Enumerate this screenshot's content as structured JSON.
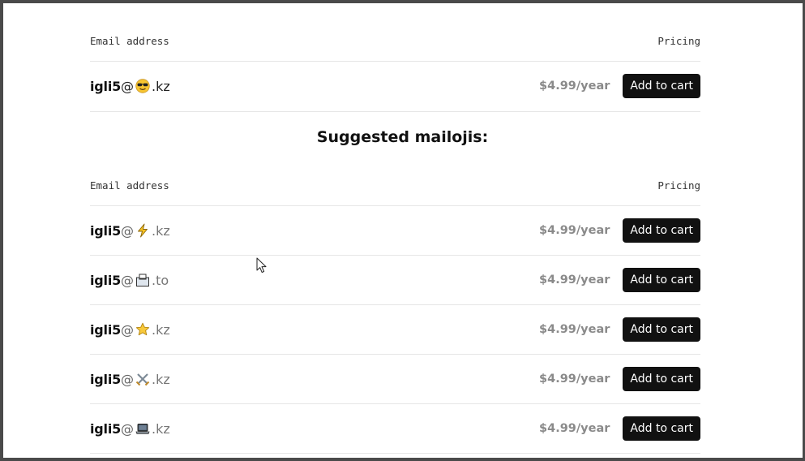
{
  "table_header": {
    "email_label": "Email address",
    "pricing_label": "Pricing"
  },
  "current": {
    "username": "igli5",
    "at": "@",
    "emoji_icon": "sunglasses-face-icon",
    "tld": ".kz",
    "price": "$4.99/year",
    "button_label": "Add to cart"
  },
  "suggested_title": "Suggested mailojis:",
  "suggested_header": {
    "email_label": "Email address",
    "pricing_label": "Pricing"
  },
  "suggestions": [
    {
      "username": "igli5",
      "at": "@",
      "emoji_icon": "lightning-bolt-icon",
      "tld": ".kz",
      "price": "$4.99/year",
      "button_label": "Add to cart"
    },
    {
      "username": "igli5",
      "at": "@",
      "emoji_icon": "ballot-box-icon",
      "tld": ".to",
      "price": "$4.99/year",
      "button_label": "Add to cart"
    },
    {
      "username": "igli5",
      "at": "@",
      "emoji_icon": "star-icon",
      "tld": ".kz",
      "price": "$4.99/year",
      "button_label": "Add to cart"
    },
    {
      "username": "igli5",
      "at": "@",
      "emoji_icon": "crossed-swords-icon",
      "tld": ".kz",
      "price": "$4.99/year",
      "button_label": "Add to cart"
    },
    {
      "username": "igli5",
      "at": "@",
      "emoji_icon": "laptop-icon",
      "tld": ".kz",
      "price": "$4.99/year",
      "button_label": "Add to cart"
    }
  ]
}
